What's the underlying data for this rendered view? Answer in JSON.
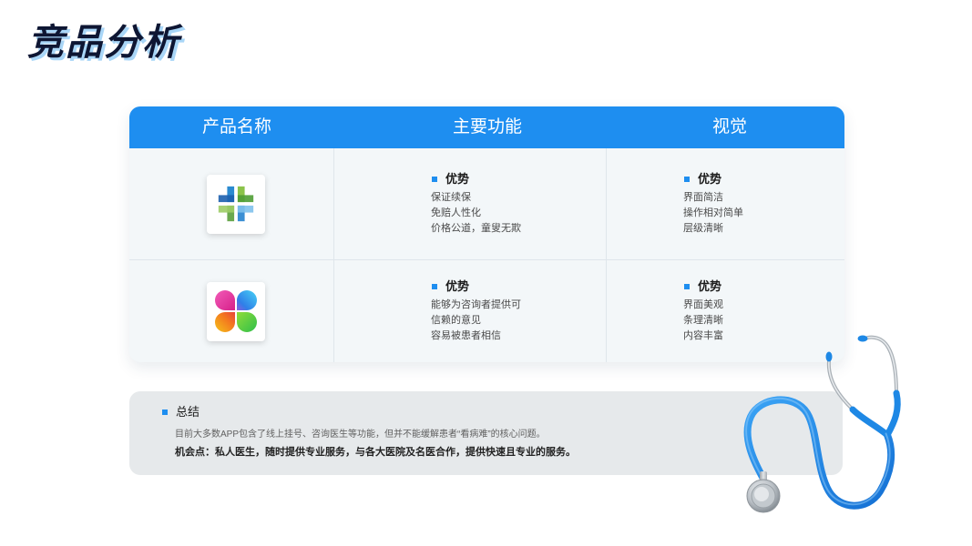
{
  "title": "竞品分析",
  "table": {
    "headers": {
      "product": "产品名称",
      "features": "主要功能",
      "visual": "视觉"
    },
    "rows": [
      {
        "icon": "cross-logo-icon",
        "features": {
          "heading": "优势",
          "items": [
            "保证续保",
            "免赔人性化",
            "价格公道，童叟无欺"
          ]
        },
        "visual": {
          "heading": "优势",
          "items": [
            "界面简洁",
            "操作相对简单",
            "层级清晰"
          ]
        }
      },
      {
        "icon": "petal-logo-icon",
        "features": {
          "heading": "优势",
          "items": [
            "能够为咨询者提供可",
            "信赖的意见",
            "容易被患者相信"
          ]
        },
        "visual": {
          "heading": "优势",
          "items": [
            "界面美观",
            "条理清晰",
            "内容丰富"
          ]
        }
      }
    ]
  },
  "summary": {
    "heading": "总结",
    "text": "目前大多数APP包含了线上挂号、咨询医生等功能，但并不能缓解患者“看病难”的核心问题。",
    "opportunity": "机会点：私人医生，随时提供专业服务，与各大医院及名医合作，提供快速且专业的服务。"
  },
  "illustration": {
    "icon": "stethoscope-icon"
  },
  "colors": {
    "accent": "#1e8ef0",
    "title_text": "#0e1633",
    "title_shadow": "#a9d6f7",
    "table_body": "#f3f7f9",
    "summary_bg": "#e6e9eb",
    "stethoscope_tube": "#1e88e5"
  }
}
